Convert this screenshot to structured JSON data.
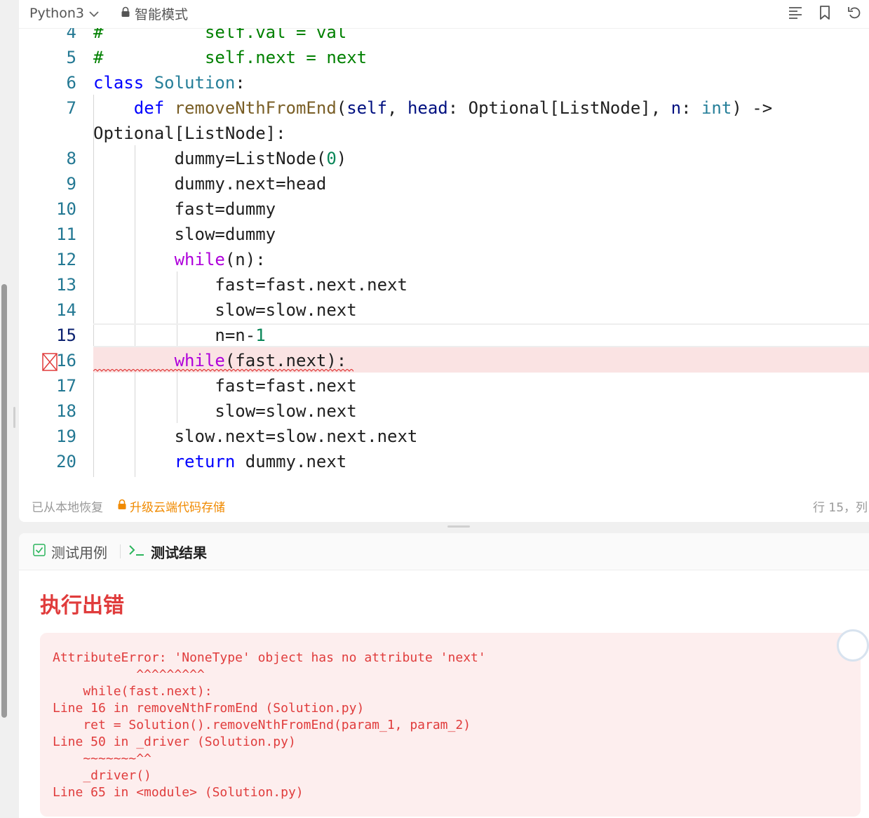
{
  "toolbar": {
    "language": "Python3",
    "mode": "智能模式"
  },
  "code_lines": [
    {
      "num": "4",
      "tokens": [
        {
          "t": "#          self.val = val",
          "c": "cmt"
        }
      ]
    },
    {
      "num": "5",
      "tokens": [
        {
          "t": "#          self.next = next",
          "c": "cmt"
        }
      ]
    },
    {
      "num": "6",
      "tokens": [
        {
          "t": "class ",
          "c": "kw-blue"
        },
        {
          "t": "Solution",
          "c": "cls"
        },
        {
          "t": ":",
          "c": ""
        }
      ]
    },
    {
      "num": "7",
      "tokens": [
        {
          "t": "    ",
          "c": ""
        },
        {
          "t": "def ",
          "c": "kw-blue"
        },
        {
          "t": "removeNthFromEnd",
          "c": "fn"
        },
        {
          "t": "(",
          "c": ""
        },
        {
          "t": "self",
          "c": "param"
        },
        {
          "t": ", ",
          "c": ""
        },
        {
          "t": "head",
          "c": "param"
        },
        {
          "t": ": Optional[ListNode], ",
          "c": ""
        },
        {
          "t": "n",
          "c": "param"
        },
        {
          "t": ": ",
          "c": ""
        },
        {
          "t": "int",
          "c": "cls"
        },
        {
          "t": ") ->",
          "c": ""
        }
      ]
    },
    {
      "num": "",
      "tokens": [
        {
          "t": "Optional[ListNode]:",
          "c": ""
        }
      ]
    },
    {
      "num": "8",
      "tokens": [
        {
          "t": "        dummy=ListNode(",
          "c": ""
        },
        {
          "t": "0",
          "c": "num"
        },
        {
          "t": ")",
          "c": ""
        }
      ]
    },
    {
      "num": "9",
      "tokens": [
        {
          "t": "        dummy.next=head",
          "c": ""
        }
      ]
    },
    {
      "num": "10",
      "tokens": [
        {
          "t": "        fast=dummy",
          "c": ""
        }
      ]
    },
    {
      "num": "11",
      "tokens": [
        {
          "t": "        slow=dummy",
          "c": ""
        }
      ]
    },
    {
      "num": "12",
      "tokens": [
        {
          "t": "        ",
          "c": ""
        },
        {
          "t": "while",
          "c": "kw-purple"
        },
        {
          "t": "(n):",
          "c": ""
        }
      ]
    },
    {
      "num": "13",
      "tokens": [
        {
          "t": "            fast=fast.next.next",
          "c": ""
        }
      ]
    },
    {
      "num": "14",
      "tokens": [
        {
          "t": "            slow=slow.next",
          "c": ""
        }
      ]
    },
    {
      "num": "15",
      "tokens": [
        {
          "t": "            n=n-",
          "c": ""
        },
        {
          "t": "1",
          "c": "num"
        }
      ]
    },
    {
      "num": "16",
      "tokens": [
        {
          "t": "        ",
          "c": ""
        },
        {
          "t": "while",
          "c": "kw-purple"
        },
        {
          "t": "(fast.next):",
          "c": ""
        }
      ]
    },
    {
      "num": "17",
      "tokens": [
        {
          "t": "            fast=fast.next",
          "c": ""
        }
      ]
    },
    {
      "num": "18",
      "tokens": [
        {
          "t": "            slow=slow.next",
          "c": ""
        }
      ]
    },
    {
      "num": "19",
      "tokens": [
        {
          "t": "        slow.next=slow.next.next",
          "c": ""
        }
      ]
    },
    {
      "num": "20",
      "tokens": [
        {
          "t": "        ",
          "c": ""
        },
        {
          "t": "return ",
          "c": "kw-blue"
        },
        {
          "t": "dummy.next",
          "c": ""
        }
      ]
    }
  ],
  "status": {
    "restored": "已从本地恢复",
    "upgrade": "升级云端代码存储",
    "cursor": "行 15，列"
  },
  "tabs": {
    "testcase": "测试用例",
    "result": "测试结果"
  },
  "result": {
    "title": "执行出错",
    "error_text": "AttributeError: 'NoneType' object has no attribute 'next'\n           ^^^^^^^^^\n    while(fast.next):\nLine 16 in removeNthFromEnd (Solution.py)\n    ret = Solution().removeNthFromEnd(param_1, param_2)\nLine 50 in _driver (Solution.py)\n    ~~~~~~~^^\n    _driver()\nLine 65 in <module> (Solution.py)"
  },
  "colors": {
    "error_red": "#e03c3c",
    "upgrade_orange": "#f08a00",
    "line_number": "#237893"
  }
}
